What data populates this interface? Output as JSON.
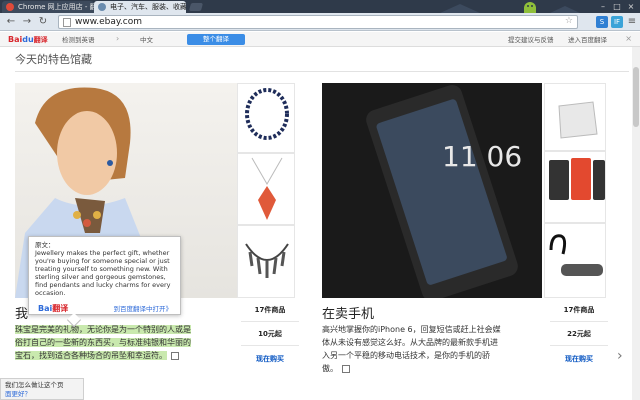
{
  "browser": {
    "tabs": [
      {
        "label": "Chrome 网上应用店 - 翻"
      },
      {
        "label": "电子、汽车、服装、收藏品"
      }
    ],
    "url": "www.ebay.com",
    "extensions": [
      {
        "label": "S",
        "color": "#2f7fd3"
      },
      {
        "label": "IF",
        "color": "#3aa3d8"
      }
    ]
  },
  "translate_bar": {
    "logo_bai": "Bai",
    "logo_du": "du",
    "logo_fanyi": "翻译",
    "source_lang": "检测到英语",
    "target_lang": "中文",
    "translate_button": "整个翻译",
    "links": [
      "提交建议与反馈",
      "进入百度翻译"
    ]
  },
  "page": {
    "section_title": "今天的特色馆藏",
    "cards": [
      {
        "title_partial": "我",
        "count_label": "17件商品",
        "price_label": "10元起",
        "buy_label": "现在购买",
        "desc": "珠宝是完美的礼物，无论你是为一个特别的人或是俗打自己的一些新的东西买，与标准纯银和华丽的宝石，找到适合各种场合的吊坠和幸运符。"
      },
      {
        "title": "在卖手机",
        "count_label": "17件商品",
        "price_label": "22元起",
        "buy_label": "现在购买",
        "desc": "高兴地掌握你的iPhone 6，回复短信或赶上社会媒体从未设有感觉这么好。从大品牌的最新款手机进入另一个平稳的移动电话技术，是你的手机的骄傲。"
      }
    ],
    "phone_time": "11 06"
  },
  "popup": {
    "source_label": "原文：",
    "source_text": "Jewellery makes the perfect gift, whether you're buying for someone special or just treating yourself to something new. With sterling silver and gorgeous gemstones, find pendants and lucky charms for every occasion.",
    "logo_bai": "Bai",
    "logo_fanyi": "翻译",
    "link": "到百度翻译中打开》"
  },
  "statusbar": {
    "line1": "我们怎么做让这个页",
    "line2": "面更好？"
  }
}
